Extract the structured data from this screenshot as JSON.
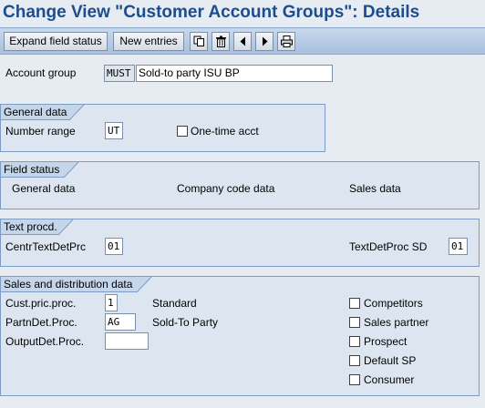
{
  "window": {
    "title": "Change View \"Customer Account Groups\": Details"
  },
  "toolbar": {
    "expand_label": "Expand field status",
    "new_entries_label": "New entries",
    "icons": [
      "copy-icon",
      "delete-icon",
      "previous-icon",
      "next-icon",
      "print-icon"
    ]
  },
  "account": {
    "label": "Account group",
    "code": "MUST",
    "description": "Sold-to party ISU BP"
  },
  "general_data": {
    "title": "General data",
    "number_range_label": "Number range",
    "number_range_value": "UT",
    "one_time_label": "One-time acct",
    "one_time_checked": false
  },
  "field_status": {
    "title": "Field status",
    "general": "General data",
    "company": "Company code data",
    "sales": "Sales data"
  },
  "text_proc": {
    "title": "Text procd.",
    "central_label": "CentrTextDetPrc",
    "central_value": "01",
    "sd_label": "TextDetProc SD",
    "sd_value": "01"
  },
  "sales_dist": {
    "title": "Sales and distribution data",
    "cust_pric_label": "Cust.pric.proc.",
    "cust_pric_value": "1",
    "cust_pric_text": "Standard",
    "partn_label": "PartnDet.Proc.",
    "partn_value": "AG",
    "partn_text": "Sold-To Party",
    "output_label": "OutputDet.Proc.",
    "output_value": "",
    "checkboxes": [
      {
        "label": "Competitors",
        "checked": false
      },
      {
        "label": "Sales partner",
        "checked": false
      },
      {
        "label": "Prospect",
        "checked": false
      },
      {
        "label": "Default SP",
        "checked": false
      },
      {
        "label": "Consumer",
        "checked": false
      }
    ]
  }
}
